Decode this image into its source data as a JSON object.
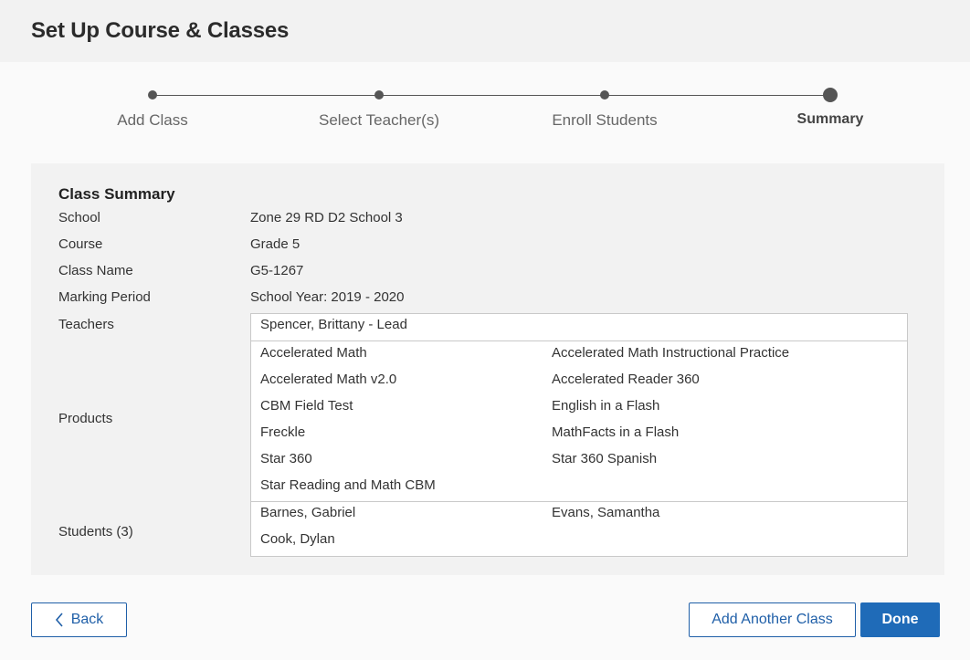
{
  "header": {
    "title": "Set Up Course & Classes"
  },
  "stepper": {
    "steps": [
      {
        "label": "Add Class"
      },
      {
        "label": "Select Teacher(s)"
      },
      {
        "label": "Enroll Students"
      },
      {
        "label": "Summary"
      }
    ],
    "active_step": "Summary"
  },
  "summary": {
    "title": "Class Summary",
    "school_label": "School",
    "school_value": "Zone 29 RD D2 School 3",
    "course_label": "Course",
    "course_value": "Grade 5",
    "class_name_label": "Class Name",
    "class_name_value": "G5-1267",
    "marking_period_label": "Marking Period",
    "marking_period_value": "School Year: 2019 - 2020",
    "teachers_label": "Teachers",
    "teachers": [
      "Spencer, Brittany - Lead"
    ],
    "products_label": "Products",
    "products": [
      "Accelerated Math",
      "Accelerated Math Instructional Practice",
      "Accelerated Math v2.0",
      "Accelerated Reader 360",
      "CBM Field Test",
      "English in a Flash",
      "Freckle",
      "MathFacts in a Flash",
      "Star 360",
      "Star 360 Spanish",
      "Star Reading and Math CBM"
    ],
    "students_label": "Students (3)",
    "students": [
      "Barnes, Gabriel",
      "Evans, Samantha",
      "Cook, Dylan"
    ]
  },
  "footer": {
    "back_label": "Back",
    "add_another_label": "Add Another Class",
    "done_label": "Done"
  },
  "colors": {
    "primary": "#1f6bb8",
    "header_bg": "#f2f2f2",
    "panel_bg": "#f2f2f2"
  }
}
